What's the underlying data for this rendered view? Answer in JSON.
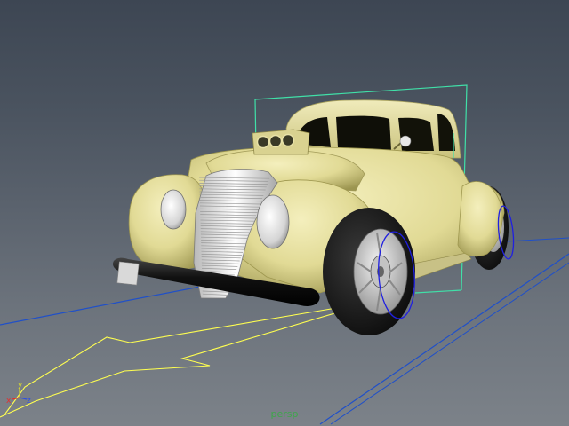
{
  "viewport": {
    "camera_name": "persp",
    "panel_type": "perspective-viewport"
  },
  "axis_gizmo": {
    "x_label": "x",
    "y_label": "y",
    "z_label": "z",
    "x_color": "#e03030",
    "y_color": "#d8d830",
    "z_color": "#3050e0"
  },
  "colors": {
    "background_top": "#3d4653",
    "background_bottom": "#7c8289",
    "car_body": "#e6e09c",
    "selection_box": "#40e0a8",
    "guide_curve": "#ffff50",
    "wheel_manipulator": "#2020e0",
    "ground_line": "#2050c8",
    "camera_label": "#3ea64a"
  },
  "scene": {
    "object_icon": "hot-rod-car-icon",
    "selected": true
  }
}
